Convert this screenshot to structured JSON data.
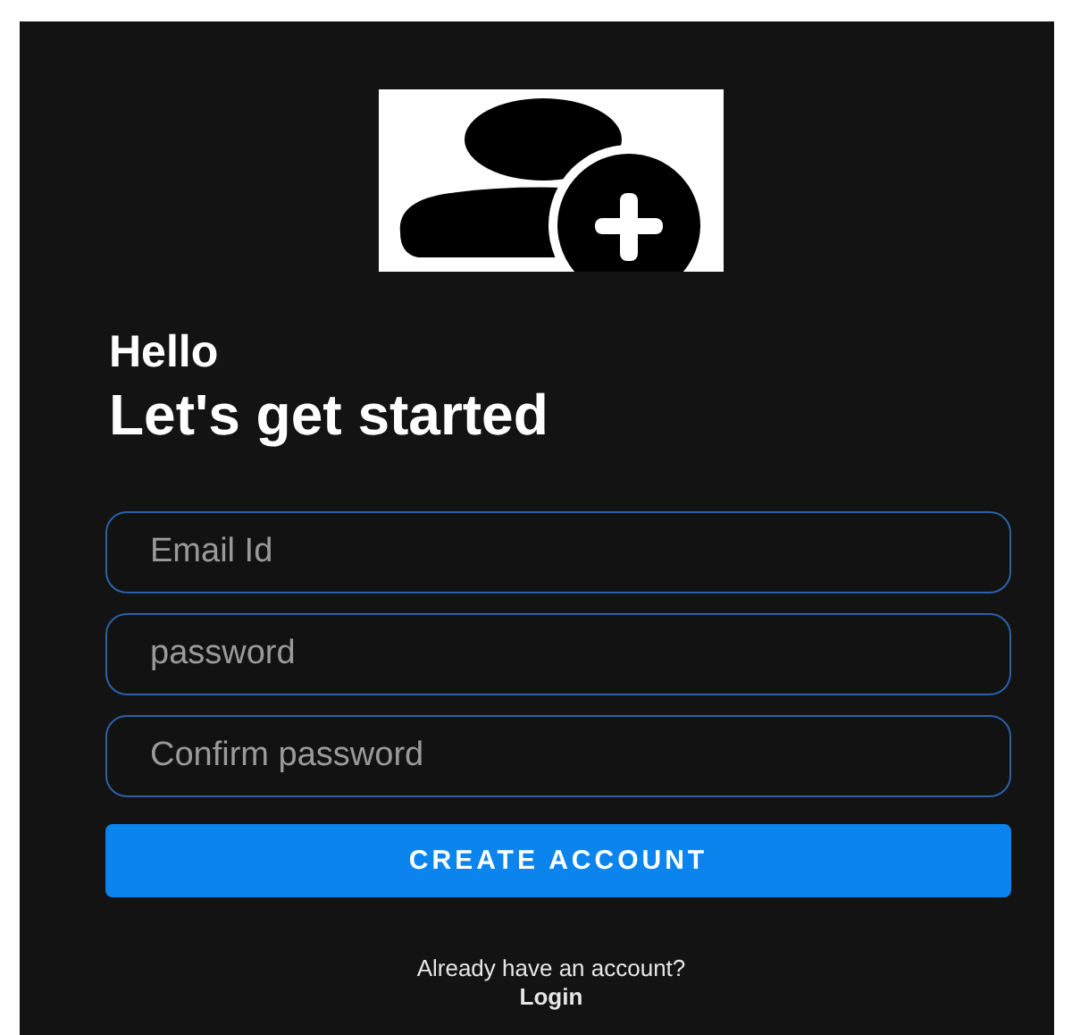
{
  "greeting": "Hello",
  "heading": "Let's get started",
  "fields": [
    {
      "placeholder": "Email Id"
    },
    {
      "placeholder": "password"
    },
    {
      "placeholder": "Confirm password"
    }
  ],
  "create_button": "CREATE ACCOUNT",
  "login_prompt": "Already have an account?",
  "login_link": "Login"
}
